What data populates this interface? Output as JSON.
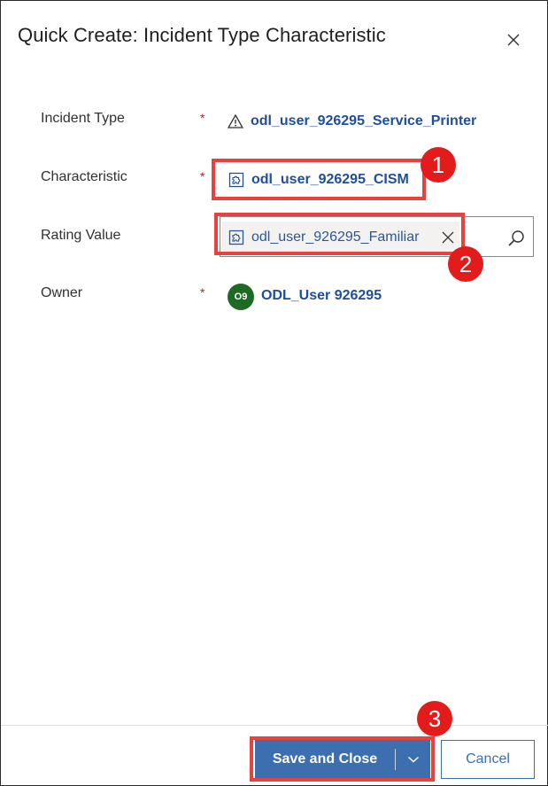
{
  "dialog": {
    "title": "Quick Create: Incident Type Characteristic",
    "close_icon": "close-icon"
  },
  "fields": {
    "incident_type": {
      "label": "Incident Type",
      "required_mark": "*",
      "value": "odl_user_926295_Service_Printer",
      "icon": "warning-triangle-icon"
    },
    "characteristic": {
      "label": "Characteristic",
      "required_mark": "*",
      "value": "odl_user_926295_CISM",
      "icon": "puzzle-icon"
    },
    "rating_value": {
      "label": "Rating Value",
      "value": "odl_user_926295_Familiar",
      "icon": "puzzle-icon",
      "clear_icon": "clear-x-icon",
      "search_icon": "search-icon"
    },
    "owner": {
      "label": "Owner",
      "required_mark": "*",
      "value": "ODL_User 926295",
      "avatar_initials": "O9",
      "avatar_color": "#1e6a24"
    }
  },
  "annotations": [
    "1",
    "2",
    "3"
  ],
  "footer": {
    "save_label": "Save and Close",
    "cancel_label": "Cancel"
  },
  "colors": {
    "link": "#1f4e9e",
    "primary": "#3d6fb0",
    "annotation": "#e8413e",
    "required": "#a4262c"
  }
}
